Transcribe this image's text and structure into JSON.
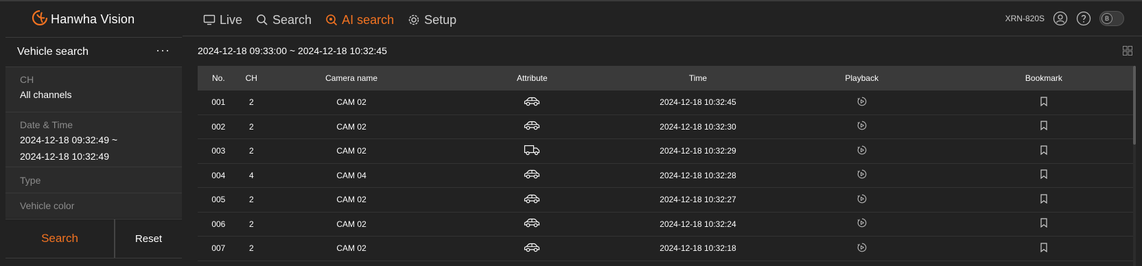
{
  "brand": {
    "name": "Hanwha Vision",
    "accent": "#f37321"
  },
  "nav": [
    {
      "label": "Live",
      "icon": "monitor-icon",
      "active": false
    },
    {
      "label": "Search",
      "icon": "search-icon",
      "active": false
    },
    {
      "label": "AI search",
      "icon": "ai-search-icon",
      "active": true
    },
    {
      "label": "Setup",
      "icon": "gear-icon",
      "active": false
    }
  ],
  "header_right": {
    "model": "XRN-820S",
    "toggle_label": "B"
  },
  "left_panel": {
    "title": "Vehicle search",
    "more": "···",
    "ch_label": "CH",
    "ch_value": "All channels",
    "datetime_label": "Date & Time",
    "datetime_from": "2024-12-18 09:32:49 ~",
    "datetime_to": "2024-12-18 10:32:49",
    "type_label": "Type",
    "color_label": "Vehicle color",
    "search_button": "Search",
    "reset_button": "Reset"
  },
  "results": {
    "range": "2024-12-18 09:33:00 ~ 2024-12-18 10:32:45",
    "columns": [
      "No.",
      "CH",
      "Camera name",
      "Attribute",
      "Time",
      "Playback",
      "Bookmark"
    ],
    "rows": [
      {
        "no": "001",
        "ch": "2",
        "camera": "CAM 02",
        "attribute": "car-icon",
        "time": "2024-12-18 10:32:45"
      },
      {
        "no": "002",
        "ch": "2",
        "camera": "CAM 02",
        "attribute": "car-icon",
        "time": "2024-12-18 10:32:30"
      },
      {
        "no": "003",
        "ch": "2",
        "camera": "CAM 02",
        "attribute": "truck-icon",
        "time": "2024-12-18 10:32:29"
      },
      {
        "no": "004",
        "ch": "4",
        "camera": "CAM 04",
        "attribute": "car-icon",
        "time": "2024-12-18 10:32:28"
      },
      {
        "no": "005",
        "ch": "2",
        "camera": "CAM 02",
        "attribute": "car-icon",
        "time": "2024-12-18 10:32:27"
      },
      {
        "no": "006",
        "ch": "2",
        "camera": "CAM 02",
        "attribute": "car-icon",
        "time": "2024-12-18 10:32:24"
      },
      {
        "no": "007",
        "ch": "2",
        "camera": "CAM 02",
        "attribute": "car-icon",
        "time": "2024-12-18 10:32:18"
      }
    ]
  }
}
